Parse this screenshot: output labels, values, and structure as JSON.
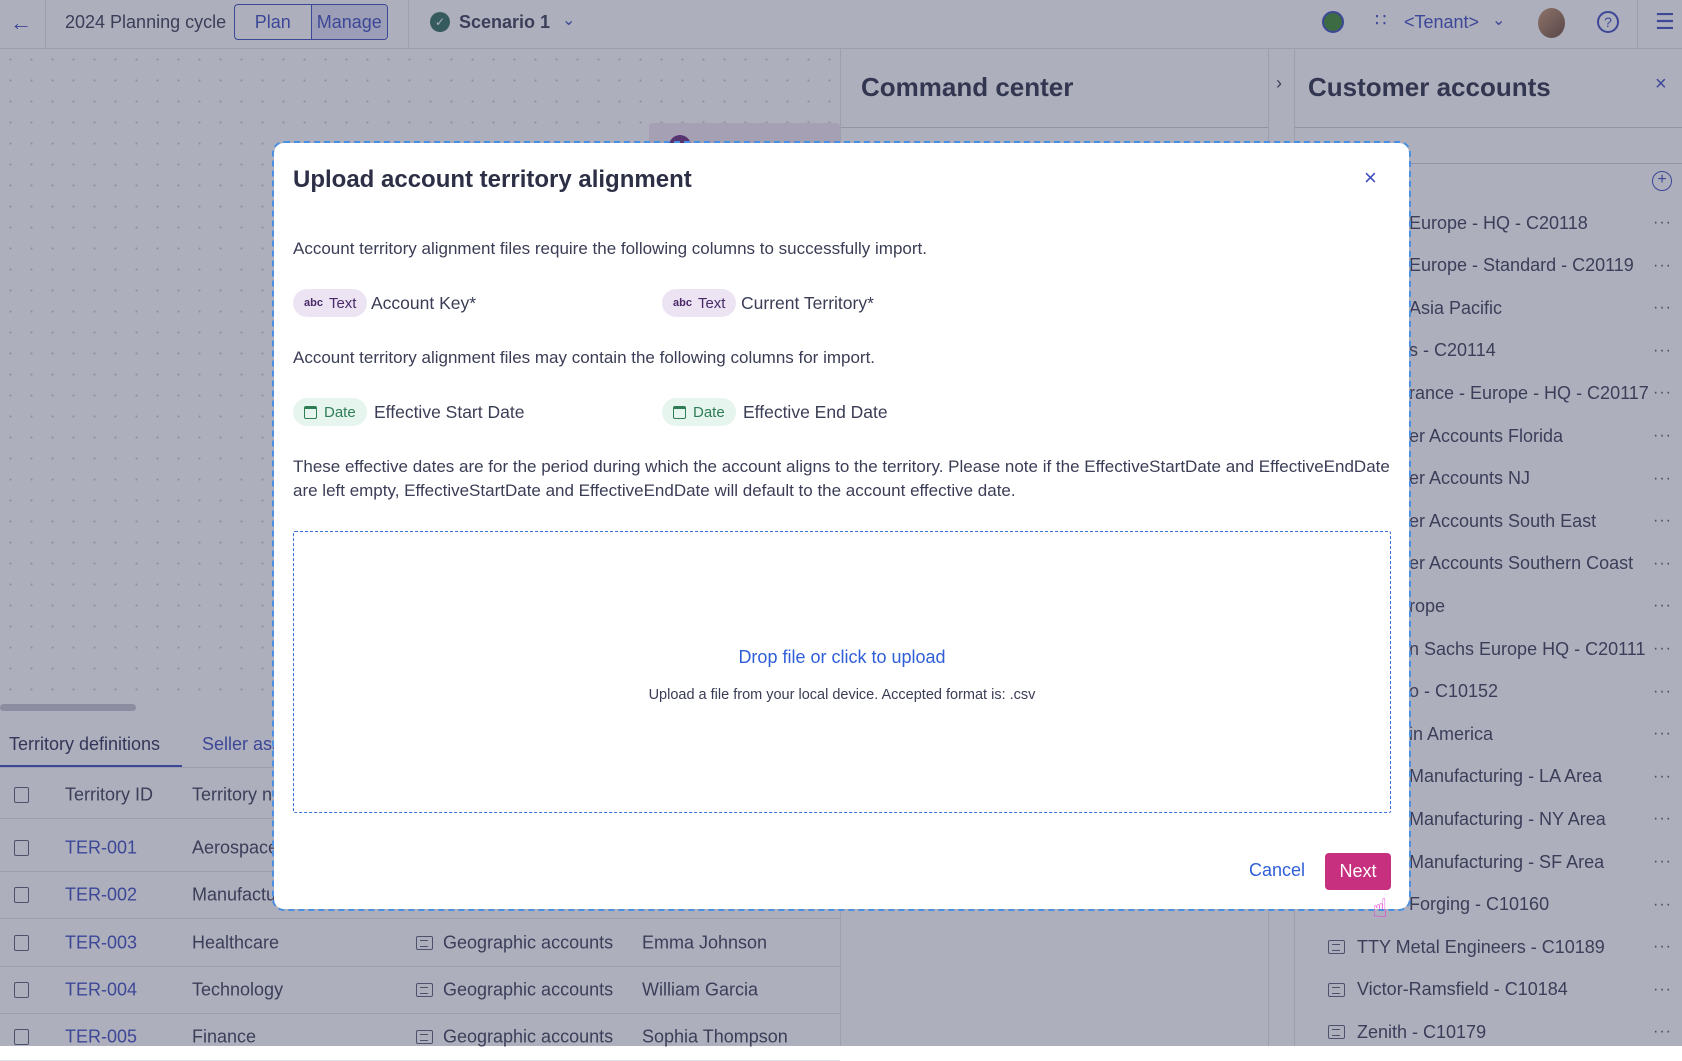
{
  "topbar": {
    "back_icon": "arrow-left-icon",
    "cycle_title": "2024 Planning cycle",
    "modes": [
      "Plan",
      "Manage"
    ],
    "active_mode": "Manage",
    "scenario": "Scenario 1",
    "tenant": "<Tenant>"
  },
  "canvas": {},
  "command_center": {
    "title": "Command center"
  },
  "customer_accounts": {
    "title": "Customer accounts",
    "items": [
      "Europe - HQ - C20118",
      "Europe - Standard - C20119",
      "Asia Pacific",
      "s - C20114",
      "rance - Europe - HQ - C20117",
      "er Accounts Florida",
      "er Accounts NJ",
      "er Accounts South East",
      "er Accounts Southern Coast",
      "rope",
      "n Sachs Europe HQ - C20111",
      "o - C10152",
      "in America",
      "Manufacturing - LA Area",
      "Manufacturing - NY Area",
      "Manufacturing - SF Area",
      "Forging - C10160"
    ],
    "full_items": [
      "TTY Metal Engineers - C10189",
      "Victor-Ramsfield - C10184",
      "Zenith - C10179"
    ]
  },
  "bottom": {
    "tabs": [
      "Territory definitions",
      "Seller ass"
    ],
    "columns": [
      "Territory ID",
      "Territory n"
    ],
    "rows": [
      {
        "id": "TER-001",
        "name": "Aerospace",
        "type": "",
        "owner": ""
      },
      {
        "id": "TER-002",
        "name": "Manufactu",
        "type": "",
        "owner": ""
      },
      {
        "id": "TER-003",
        "name": "Healthcare",
        "type": "Geographic accounts",
        "owner": "Emma Johnson"
      },
      {
        "id": "TER-004",
        "name": "Technology",
        "type": "Geographic accounts",
        "owner": "William Garcia"
      },
      {
        "id": "TER-005",
        "name": "Finance",
        "type": "Geographic accounts",
        "owner": "Sophia Thompson"
      }
    ]
  },
  "modal": {
    "title": "Upload account territory alignment",
    "required_intro": "Account territory alignment files require the following columns to successfully import.",
    "required": [
      {
        "type": "Text",
        "type_icon": "abc",
        "name": "Account Key*"
      },
      {
        "type": "Text",
        "type_icon": "abc",
        "name": "Current Territory*"
      }
    ],
    "optional_intro": "Account territory alignment files may contain the following columns for import.",
    "optional": [
      {
        "type": "Date",
        "type_icon": "calendar-icon",
        "name": "Effective Start Date"
      },
      {
        "type": "Date",
        "type_icon": "calendar-icon",
        "name": "Effective End Date"
      }
    ],
    "note": "These effective dates are for the period during which the account aligns to the territory. Please note if the EffectiveStartDate and EffectiveEndDate are left empty, EffectiveStartDate and EffectiveEndDate will default to the account effective date.",
    "drop_title": "Drop file or click to upload",
    "drop_sub": "Upload a file from your local device. Accepted format is: .csv",
    "cancel": "Cancel",
    "next": "Next"
  },
  "colors": {
    "accent": "#3b4cc0",
    "primary_button": "#c7307f",
    "text_chip": "#ece4f3",
    "date_chip": "#e6f5ee",
    "status_dot": "#3d8b2f"
  }
}
